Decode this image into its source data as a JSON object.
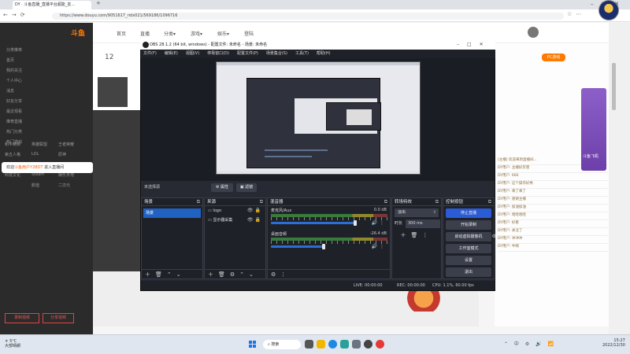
{
  "browser": {
    "tab_title": "DY · 斗鱼直播_直播平台超能_友…",
    "url": "https://www.douyu.com/9051617_ridx021/569186/1096716"
  },
  "site": {
    "nav": [
      "首页",
      "直播",
      "分类▾",
      "游戏▾",
      "娱乐▾",
      "登陆"
    ],
    "fan_count": "12",
    "pc_game_label": "PC游戏",
    "welcome_prefix": "欢迎",
    "welcome_name": "斗鱼用户Y2BDT",
    "welcome_suffix": " 进入直播间",
    "video_btn_1": "录制视频",
    "video_btn_2": "分享视频",
    "sidebar_items": [
      "分类推荐",
      "首页",
      "我的关注",
      "个人中心",
      "消息",
      "好友分享",
      "最近观看",
      "推荐直播",
      "热门分类",
      "热门游戏",
      "英雄联盟",
      "王者荣耀",
      "和平精英",
      "LOL",
      "原神",
      "第五人格",
      "单机游戏",
      "主机游戏",
      "手游",
      "Steam",
      "娱乐天地",
      "科技文化",
      "颜值",
      "二次元"
    ],
    "chat_lines": [
      "[主播] 欢迎来到直播间...",
      "DY用户: 主播好厉害",
      "DY用户: 666",
      "DY用户: 这个操作好秀",
      "DY用户: 来了来了",
      "DY用户: 感谢主播",
      "DY用户: 加油加油",
      "DY用户: 哈哈哈哈",
      "DY用户: 好看",
      "DY用户: 关注了",
      "DY用户: 冲冲冲",
      "DY用户: 牛啊"
    ],
    "banner_text": "斗鱼飞机"
  },
  "obs": {
    "title": "OBS 28.1.2 (64 bit, windows) - 配置文件: 未命名 - 场景: 未命名",
    "menu": [
      "文件(F)",
      "编辑(E)",
      "视图(V)",
      "停靠窗口(D)",
      "配置文件(P)",
      "场景集合(S)",
      "工具(T)",
      "帮助(H)"
    ],
    "scene_label": "未选择源",
    "props_btn": "⚙ 属性",
    "filters_btn": "▣ 滤镜",
    "docks": {
      "scenes": "场景",
      "sources": "来源",
      "mixer": "混音器",
      "transitions": "转场特效",
      "controls": "控制按钮"
    },
    "scene_items": [
      "场景"
    ],
    "source_items": [
      {
        "icon": "▭",
        "name": "logo"
      },
      {
        "icon": "▭",
        "name": "显示器采集"
      }
    ],
    "mixer_tracks": [
      {
        "name": "麦克风/Aux",
        "db": "0.0 dB",
        "fader": 0.72
      },
      {
        "name": "桌面音频",
        "db": "-26.4 dB",
        "fader": 0.45
      }
    ],
    "transition": {
      "type": "淡出",
      "duration_label": "时长",
      "duration_value": "300 ms"
    },
    "controls": [
      {
        "label": "停止直播",
        "active": true
      },
      {
        "label": "开始录制",
        "active": false
      },
      {
        "label": "启动虚拟摄像机",
        "active": false
      },
      {
        "label": "工作室模式",
        "active": false
      },
      {
        "label": "设置",
        "active": false
      },
      {
        "label": "退出",
        "active": false
      }
    ],
    "status": {
      "live": "LIVE: 00:00:00",
      "rec": "REC: 00:00:00",
      "cpu": "CPU: 1.1%, 60.00 fps"
    }
  },
  "taskbar": {
    "weather_temp": "5°C",
    "weather_desc": "大部晴朗",
    "search": "搜索",
    "time": "15:27",
    "date": "2022/12/30"
  }
}
